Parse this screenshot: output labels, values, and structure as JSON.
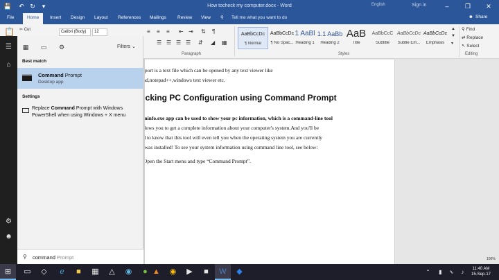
{
  "window": {
    "title": "How tocheck my computer.docx - Word",
    "user": "English",
    "signin": "Sign in"
  },
  "ribbon_tabs": [
    "File",
    "Home",
    "Insert",
    "Design",
    "Layout",
    "References",
    "Mailings",
    "Review",
    "View"
  ],
  "tellme": "Tell me what you want to do",
  "share": "Share",
  "ribbon": {
    "font_name": "Calibri (Body)",
    "font_size": "12",
    "paste_cut": "Cut",
    "groups": [
      "Paragraph",
      "Styles",
      "Editing"
    ],
    "styles": [
      {
        "sample": "AaBbCcDc",
        "name": "¶ Normal"
      },
      {
        "sample": "AaBbCcDc",
        "name": "¶ No Spac..."
      },
      {
        "sample": "1 AaBl",
        "name": "Heading 1"
      },
      {
        "sample": "1.1 AaBb",
        "name": "Heading 2"
      },
      {
        "sample": "AaB",
        "name": "Title"
      },
      {
        "sample": "AaBbCcC",
        "name": "Subtitle"
      },
      {
        "sample": "AaBbCcDc",
        "name": "Subtle Em..."
      },
      {
        "sample": "AaBbCcDc",
        "name": "Emphasis"
      }
    ],
    "editing": [
      "Find",
      "Replace",
      "Select"
    ]
  },
  "document": {
    "line1": "report is a text file which can be opened by any text viewer like",
    "line2": "pad,notepad++,windows text viewer etc.",
    "heading": "ecking PC Configuration using Command Prompt",
    "p1": "eminfo.exe app can be used to show your pc information, which is a command-line tool",
    "p2": "allows you to get a complete information about your computer's system.And you'll be",
    "p3": "ed to know that this tool will even tell you when the operating system you are currently",
    "p4": "g was installed! To see your system information using command line tool, see below:",
    "p5": "Open the Start menu and type “Command Prompt”."
  },
  "start": {
    "filters_label": "Filters",
    "best_match_label": "Best match",
    "best_match_title_bold": "Command",
    "best_match_title_rest": " Prompt",
    "best_match_sub": "Desktop app",
    "settings_label": "Settings",
    "setting_line1_a": "Replace ",
    "setting_line1_bold": "Command",
    "setting_line1_b": " Prompt with Windows",
    "setting_line2": "PowerShell when using Windows + X menu",
    "search_typed": "command",
    "search_ghost": " Prompt"
  },
  "taskbar": {
    "time": "11:40 AM",
    "date": "15-Sep-17",
    "percent": "100%"
  }
}
